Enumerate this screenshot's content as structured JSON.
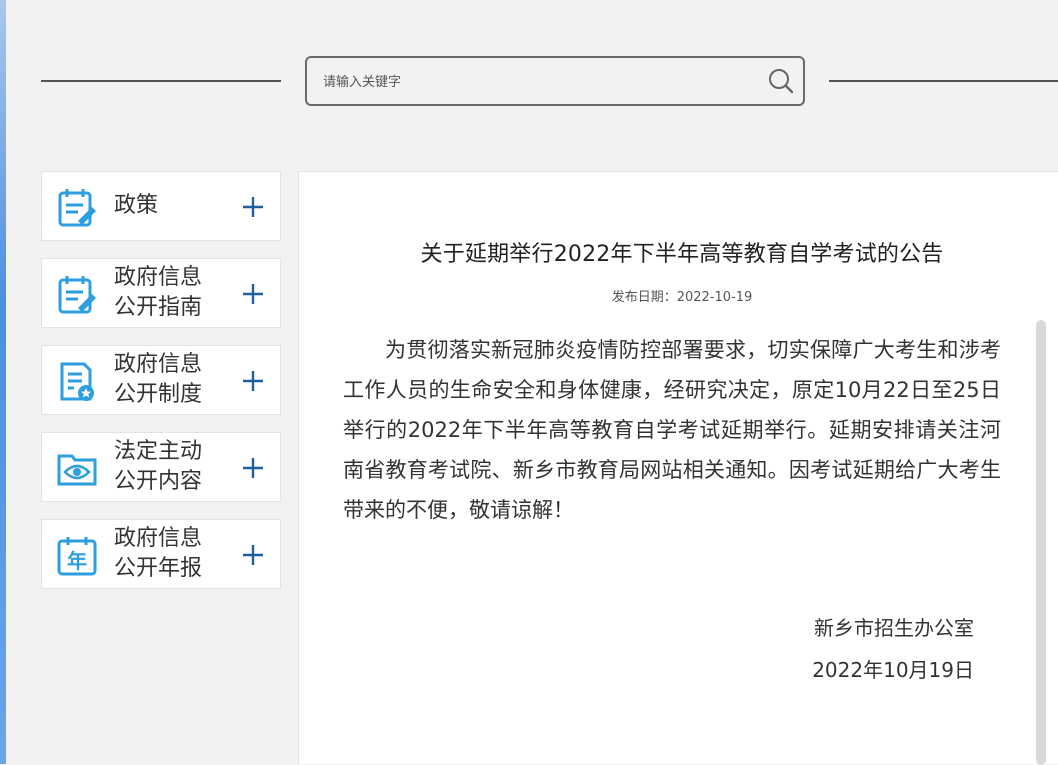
{
  "search": {
    "placeholder": "请输入关键字"
  },
  "sidebar": {
    "items": [
      {
        "label": "政策",
        "icon": "policy-doc-icon"
      },
      {
        "label": "政府信息\n公开指南",
        "icon": "guide-doc-icon"
      },
      {
        "label": "政府信息\n公开制度",
        "icon": "system-doc-icon"
      },
      {
        "label": "法定主动\n公开内容",
        "icon": "folder-eye-icon"
      },
      {
        "label": "政府信息\n公开年报",
        "icon": "annual-calendar-icon"
      }
    ]
  },
  "article": {
    "title": "关于延期举行2022年下半年高等教育自学考试的公告",
    "date_label": "发布日期：2022-10-19",
    "body": "为贯彻落实新冠肺炎疫情防控部署要求，切实保障广大考生和涉考工作人员的生命安全和身体健康，经研究决定，原定10月22日至25日举行的2022年下半年高等教育自学考试延期举行。延期安排请关注河南省教育考试院、新乡市教育局网站相关通知。因考试延期给广大考生带来的不便，敬请谅解！",
    "signature_org": "新乡市招生办公室",
    "signature_date": "2022年10月19日"
  },
  "colors": {
    "accent": "#2d9ee0",
    "plus": "#1f5f9e",
    "background": "#f2f2f2"
  }
}
